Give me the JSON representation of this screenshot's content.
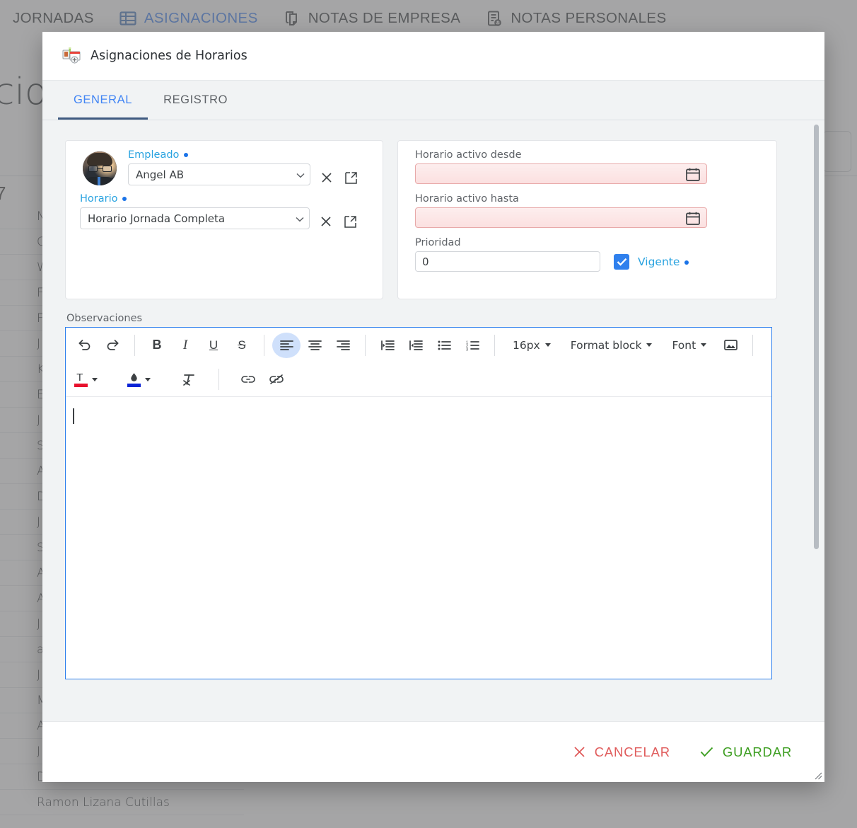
{
  "background": {
    "nav_tabs": [
      {
        "label": "JORNADAS",
        "icon": "",
        "active": false
      },
      {
        "label": "ASIGNACIONES",
        "icon": "table-icon",
        "active": true
      },
      {
        "label": "NOTAS DE EMPRESA",
        "icon": "notes-company-icon",
        "active": false
      },
      {
        "label": "NOTAS PERSONALES",
        "icon": "notes-personal-icon",
        "active": false
      }
    ],
    "page_title": "acio",
    "count_label": "7",
    "list_rows": [
      "N",
      "C",
      "W",
      "F",
      "F",
      "J",
      "K",
      "E",
      "J",
      "S",
      "A",
      "D",
      "J",
      "S",
      "A",
      "A",
      "J",
      "a",
      "J",
      "M",
      "A",
      "J",
      "Damian Galiana Gonzalez",
      "Ramon Lizana Cutillas"
    ]
  },
  "modal": {
    "title": "Asignaciones de Horarios",
    "title_icon": "schedule-assignment-icon",
    "tabs": [
      {
        "label": "GENERAL",
        "active": true
      },
      {
        "label": "REGISTRO",
        "active": false
      }
    ],
    "left_card": {
      "avatar": "employee-avatar",
      "employee": {
        "label": "Empleado",
        "value": "Angel AB",
        "clear_icon": "close-icon",
        "open_icon": "open-in-new-icon"
      },
      "schedule": {
        "label": "Horario",
        "value": "Horario Jornada Completa",
        "clear_icon": "close-icon",
        "open_icon": "open-in-new-icon"
      }
    },
    "right_card": {
      "active_from": {
        "label": "Horario activo desde",
        "value": "",
        "icon": "calendar-icon"
      },
      "active_to": {
        "label": "Horario activo hasta",
        "value": "",
        "icon": "calendar-icon"
      },
      "priority": {
        "label": "Prioridad",
        "value": "0"
      },
      "vigente": {
        "label": "Vigente",
        "checked": true
      }
    },
    "observations": {
      "label": "Observaciones",
      "content": "",
      "toolbar_row1": [
        {
          "name": "undo-icon",
          "glyph": "↺",
          "type": "icon"
        },
        {
          "name": "redo-icon",
          "glyph": "↻",
          "type": "icon"
        },
        {
          "name": "separator",
          "type": "sep"
        },
        {
          "name": "bold-icon",
          "glyph": "B",
          "type": "icon"
        },
        {
          "name": "italic-icon",
          "glyph": "I",
          "type": "icon"
        },
        {
          "name": "underline-icon",
          "glyph": "U",
          "type": "icon"
        },
        {
          "name": "strikethrough-icon",
          "glyph": "S",
          "type": "icon"
        },
        {
          "name": "separator",
          "type": "sep"
        },
        {
          "name": "align-left-icon",
          "type": "icon",
          "active": true
        },
        {
          "name": "align-center-icon",
          "type": "icon"
        },
        {
          "name": "align-right-icon",
          "type": "icon"
        },
        {
          "name": "separator",
          "type": "sep"
        },
        {
          "name": "indent-increase-icon",
          "type": "icon"
        },
        {
          "name": "indent-decrease-icon",
          "type": "icon"
        },
        {
          "name": "bullet-list-icon",
          "type": "icon"
        },
        {
          "name": "numbered-list-icon",
          "type": "icon"
        },
        {
          "name": "separator",
          "type": "sep"
        },
        {
          "name": "font-size-dropdown",
          "label": "16px",
          "type": "drop"
        },
        {
          "name": "format-block-dropdown",
          "label": "Format block",
          "type": "drop"
        },
        {
          "name": "font-dropdown",
          "label": "Font",
          "type": "drop"
        },
        {
          "name": "insert-image-icon",
          "type": "icon"
        },
        {
          "name": "separator",
          "type": "sep"
        }
      ],
      "toolbar_row2": [
        {
          "name": "text-color-picker",
          "color": "#e8112d"
        },
        {
          "name": "highlight-color-picker",
          "color": "#0a23d6"
        },
        {
          "name": "clear-format-icon"
        },
        {
          "name": "separator"
        },
        {
          "name": "insert-link-icon"
        },
        {
          "name": "remove-link-icon"
        }
      ],
      "font_size_label": "16px",
      "format_block_label": "Format block",
      "font_label": "Font"
    },
    "footer": {
      "cancel_label": "CANCELAR",
      "save_label": "GUARDAR",
      "cancel_icon": "close-icon",
      "save_icon": "check-icon"
    }
  },
  "colors": {
    "accent_blue": "#4285f4",
    "link_blue": "#29a3e0",
    "cancel_red": "#e05c5c",
    "save_green": "#3c9e20",
    "editor_border": "#2f80ed",
    "required_pink": "#e8a9a9"
  }
}
